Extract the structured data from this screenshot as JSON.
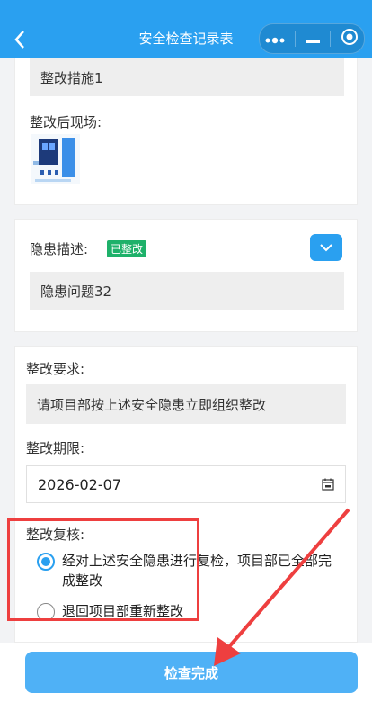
{
  "header": {
    "title": "安全检查记录表",
    "back_icon": "chevron-left-icon"
  },
  "card1": {
    "measure_value": "整改措施1",
    "after_scene_label": "整改后现场:"
  },
  "card2": {
    "hazard_label": "隐患描述:",
    "status_badge": "已整改",
    "hazard_value": "隐患问题32"
  },
  "card3": {
    "requirement_label": "整改要求:",
    "requirement_value": "请项目部按上述安全隐患立即组织整改",
    "deadline_label": "整改期限:",
    "deadline_value": "2026-02-07",
    "review_label": "整改复核:",
    "option_pass": "经对上述安全隐患进行复检，项目部已全部完成整改",
    "option_return": "退回项目部重新整改"
  },
  "footer": {
    "submit_label": "检查完成"
  },
  "colors": {
    "primary": "#2aa0f0",
    "badge": "#1eb16a",
    "annotation": "#ee3f3f"
  }
}
